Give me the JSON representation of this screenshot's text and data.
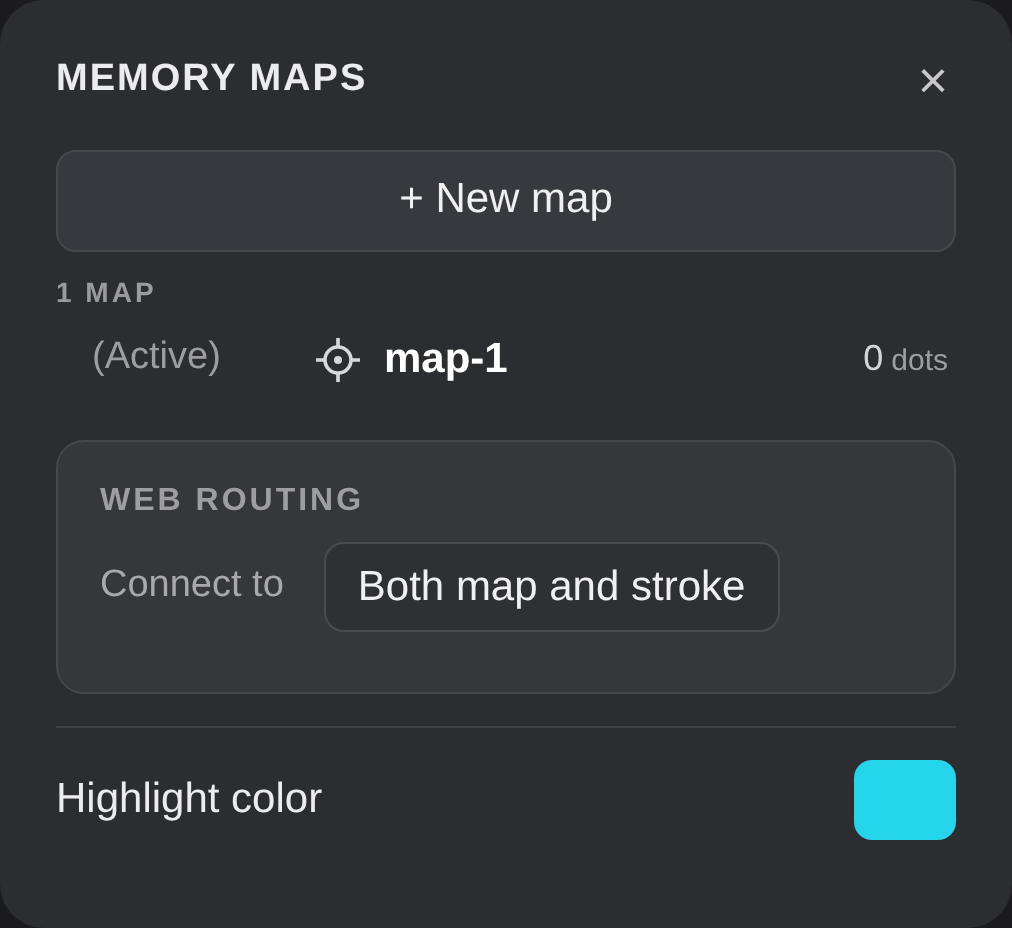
{
  "panel": {
    "title": "MEMORY MAPS",
    "close": "×"
  },
  "new_map_button": "+ New map",
  "maps_heading": "1 MAP",
  "maps": [
    {
      "status": "(Active)",
      "name": "map-1",
      "count": "0",
      "unit": "dots"
    }
  ],
  "web_routing": {
    "heading": "WEB ROUTING",
    "label": "Connect to",
    "value": "Both map and stroke"
  },
  "highlight": {
    "label": "Highlight color",
    "color": "#25d5ec"
  }
}
